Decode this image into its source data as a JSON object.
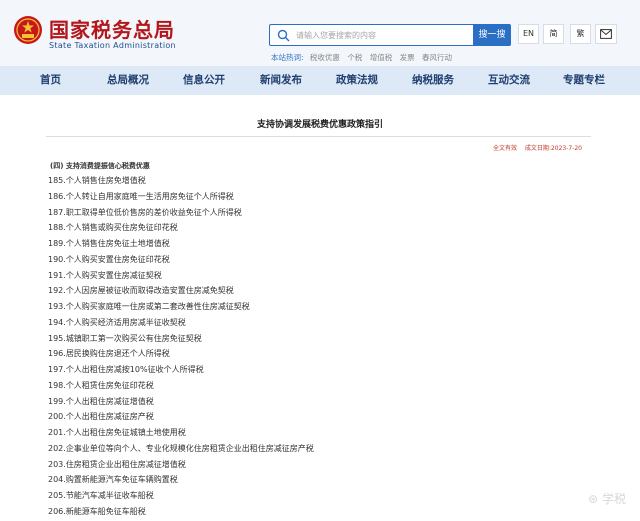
{
  "colors": {
    "brand_red": "#b3171b",
    "accent_blue": "#2b6fc4",
    "nav_bg": "#dde9f6",
    "status_red": "#c0392b"
  },
  "header": {
    "logo_cn": "国家税务总局",
    "logo_en": "State Taxation Administration",
    "search": {
      "placeholder": "请输入您要搜索的内容",
      "button": "搜一搜"
    },
    "hot_label": "本站热词:",
    "hot_words": [
      "税收优惠",
      "个税",
      "增值税",
      "发票",
      "春风行动"
    ],
    "lang_en": "EN",
    "lang_jian": "简",
    "lang_fan": "繁",
    "mail_icon": "mail-icon"
  },
  "nav": [
    "首页",
    "总局概况",
    "信息公开",
    "新闻发布",
    "政策法规",
    "纳税服务",
    "互动交流",
    "专题专栏"
  ],
  "article": {
    "title": "支持协调发展税费优惠政策指引",
    "status": "全文有效",
    "date": "成文日期:2023-7-20",
    "section": "(四) 支持消费提振信心税费优惠",
    "items": [
      "185.个人销售住房免增值税",
      "186.个人转让自用家庭唯一生活用房免征个人所得税",
      "187.职工取得单位低价售房的差价收益免征个人所得税",
      "188.个人销售或购买住房免征印花税",
      "189.个人销售住房免征土地增值税",
      "190.个人购买安置住房免征印花税",
      "191.个人购买安置住房减征契税",
      "192.个人因房屋被征收而取得改造安置住房减免契税",
      "193.个人购买家庭唯一住房或第二套改善性住房减征契税",
      "194.个人购买经济适用房减半征收契税",
      "195.城镇职工第一次购买公有住房免征契税",
      "196.居民换购住房退还个人所得税",
      "197.个人出租住房减按10%征收个人所得税",
      "198.个人租赁住房免征印花税",
      "199.个人出租住房减征增值税",
      "200.个人出租住房减征房产税",
      "201.个人出租住房免征城镇土地使用税",
      "202.企事业单位等向个人、专业化规模化住房租赁企业出租住房减征房产税",
      "203.住房租赁企业出租住房减征增值税",
      "204.购置新能源汽车免征车辆购置税",
      "205.节能汽车减半征收车船税",
      "206.新能源车船免征车船税"
    ]
  },
  "watermark": "⊛ 学税"
}
